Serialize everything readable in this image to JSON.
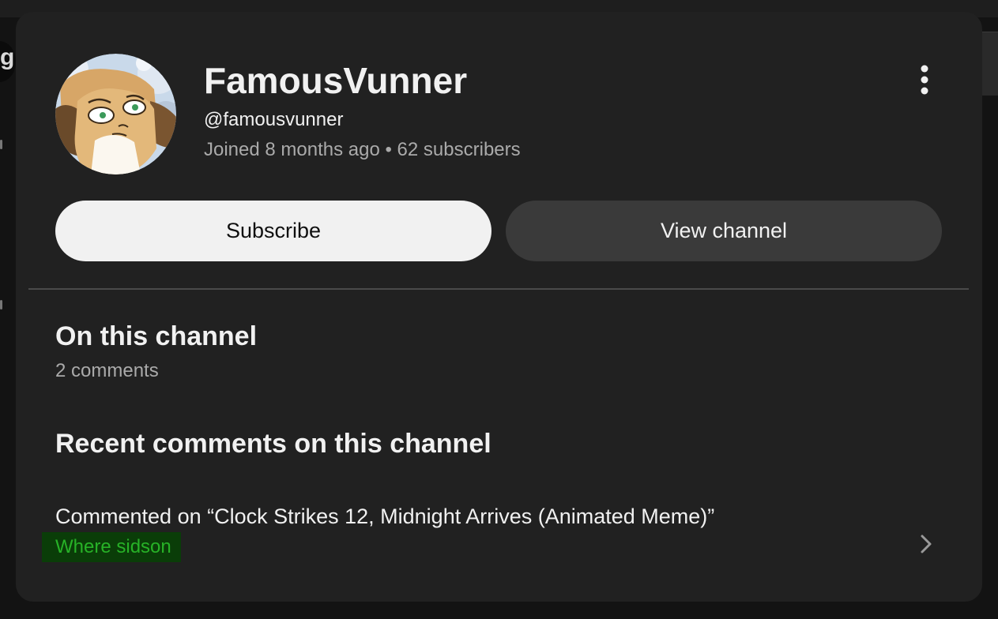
{
  "channel": {
    "name": "FamousVunner",
    "handle": "@famousvunner",
    "meta": "Joined 8 months ago • 62 subscribers",
    "avatar_icon": "furry-character-avatar"
  },
  "actions": {
    "subscribe_label": "Subscribe",
    "view_channel_label": "View channel",
    "more_icon": "more-vertical-icon"
  },
  "on_channel": {
    "title": "On this channel",
    "comment_count": "2 comments"
  },
  "recent": {
    "title": "Recent comments on this channel",
    "comments": [
      {
        "headline": "Commented on “Clock Strikes 12, Midnight Arrives (Animated Meme)”",
        "text": "Where sidson",
        "chevron_icon": "chevron-right-icon"
      }
    ]
  },
  "colors": {
    "card_bg": "#212121",
    "page_bg": "#131313",
    "subscribe_bg": "#f1f1f1",
    "view_channel_bg": "#3a3a3a",
    "primary_text": "#f1f1f1",
    "secondary_text": "#aaaaaa",
    "highlight_bg": "#0a3d08",
    "highlight_text": "#27b227"
  }
}
